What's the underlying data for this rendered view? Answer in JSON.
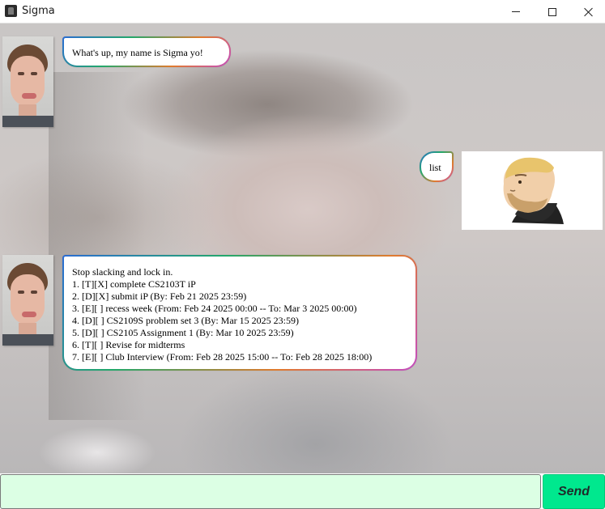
{
  "window": {
    "title": "Sigma"
  },
  "chat": {
    "messages": [
      {
        "sender": "bot",
        "lines": [
          "What's up, my name is Sigma yo!"
        ]
      },
      {
        "sender": "user",
        "lines": [
          "list"
        ]
      },
      {
        "sender": "bot",
        "lines": [
          "Stop slacking and lock in.",
          "1. [T][X] complete CS2103T iP",
          "2. [D][X] submit iP (By: Feb 21 2025 23:59)",
          "3. [E][ ] recess week (From: Feb 24 2025 00:00 -- To: Mar 3 2025 00:00)",
          "4. [D][ ] CS2109S problem set 3 (By: Mar 15 2025 23:59)",
          "5. [D][ ] CS2105 Assignment 1 (By: Mar 10 2025 23:59)",
          "6. [T][ ] Revise for midterms",
          "7. [E][ ] Club Interview (From: Feb 28 2025 15:00 -- To: Feb 28 2025 18:00)"
        ]
      }
    ]
  },
  "input": {
    "value": "",
    "send_label": "Send"
  },
  "colors": {
    "input_bg": "#dcffe4",
    "send_bg": "#00e88e"
  }
}
